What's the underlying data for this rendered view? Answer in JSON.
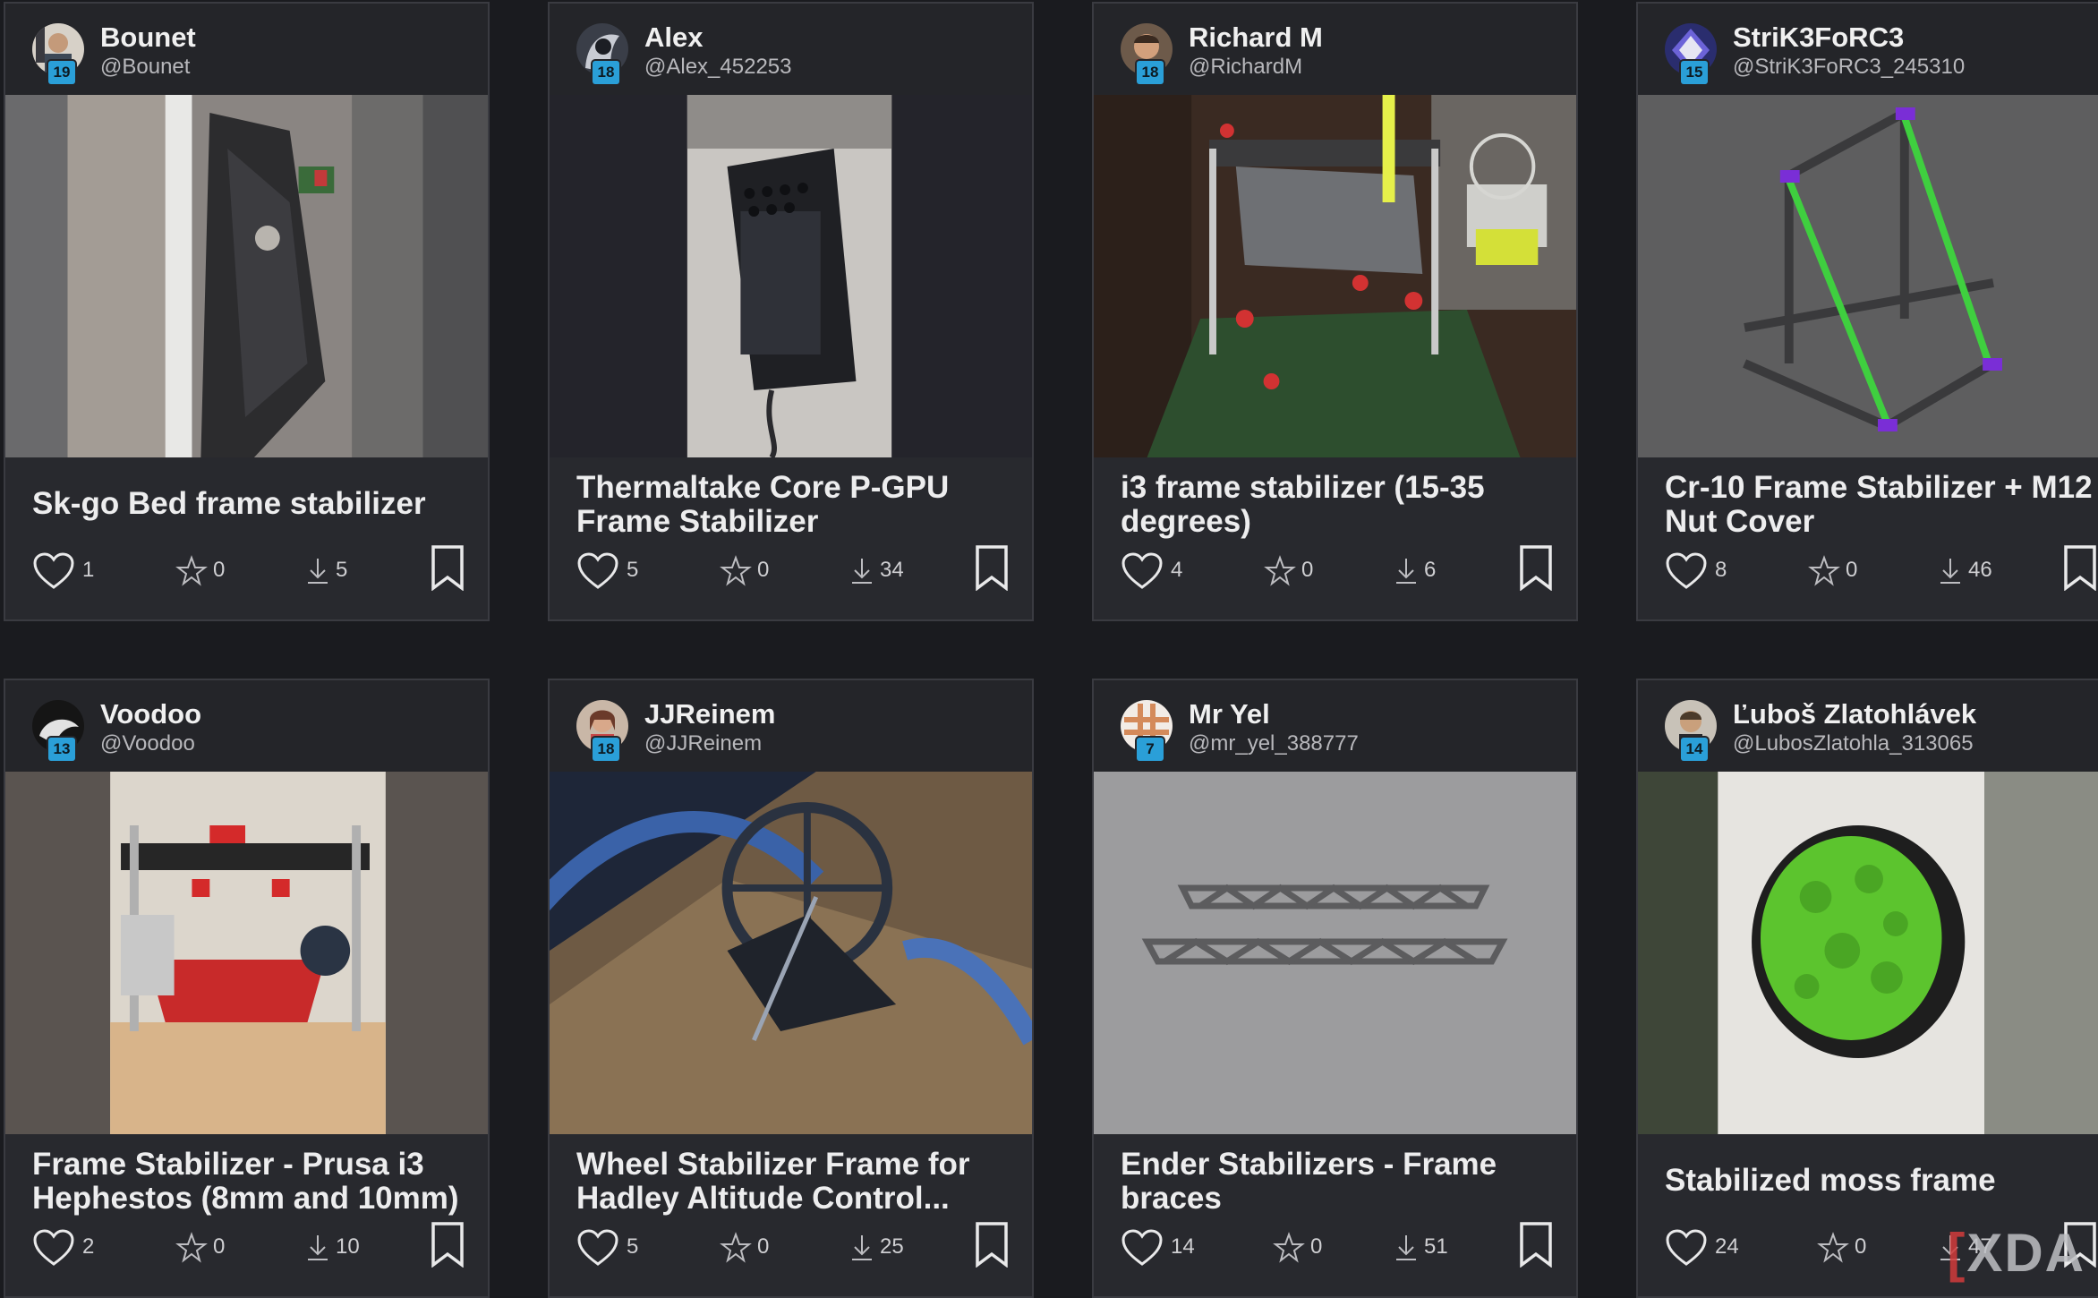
{
  "cards": [
    {
      "user": "Bounet",
      "handle": "@Bounet",
      "level": "19",
      "title": "Sk-go Bed frame stabilizer",
      "likes": "1",
      "favs": "0",
      "downloads": "5"
    },
    {
      "user": "Alex",
      "handle": "@Alex_452253",
      "level": "18",
      "title": "Thermaltake Core P-GPU Frame Stabilizer",
      "likes": "5",
      "favs": "0",
      "downloads": "34"
    },
    {
      "user": "Richard M",
      "handle": "@RichardM",
      "level": "18",
      "title": "i3 frame stabilizer (15-35 degrees)",
      "likes": "4",
      "favs": "0",
      "downloads": "6"
    },
    {
      "user": "StriK3FoRC3",
      "handle": "@StriK3FoRC3_245310",
      "level": "15",
      "title": "Cr-10 Frame Stabilizer + M12 Nut Cover",
      "likes": "8",
      "favs": "0",
      "downloads": "46"
    },
    {
      "user": "Voodoo",
      "handle": "@Voodoo",
      "level": "13",
      "title": "Frame Stabilizer - Prusa i3 Hephestos (8mm and 10mm)",
      "likes": "2",
      "favs": "0",
      "downloads": "10"
    },
    {
      "user": "JJReinem",
      "handle": "@JJReinem",
      "level": "18",
      "title": "Wheel Stabilizer Frame for Hadley Altitude Control...",
      "likes": "5",
      "favs": "0",
      "downloads": "25"
    },
    {
      "user": "Mr Yel",
      "handle": "@mr_yel_388777",
      "level": "7",
      "title": "Ender Stabilizers - Frame braces",
      "likes": "14",
      "favs": "0",
      "downloads": "51"
    },
    {
      "user": "Ľuboš Zlatohlávek",
      "handle": "@LubosZlatohla_313065",
      "level": "14",
      "title": "Stabilized moss frame",
      "likes": "24",
      "favs": "0",
      "downloads": "47"
    }
  ],
  "watermark": "XDA",
  "colors": {
    "background": "#1a1b1f",
    "card": "#28292e",
    "level_badge": "#2a9fd8"
  }
}
